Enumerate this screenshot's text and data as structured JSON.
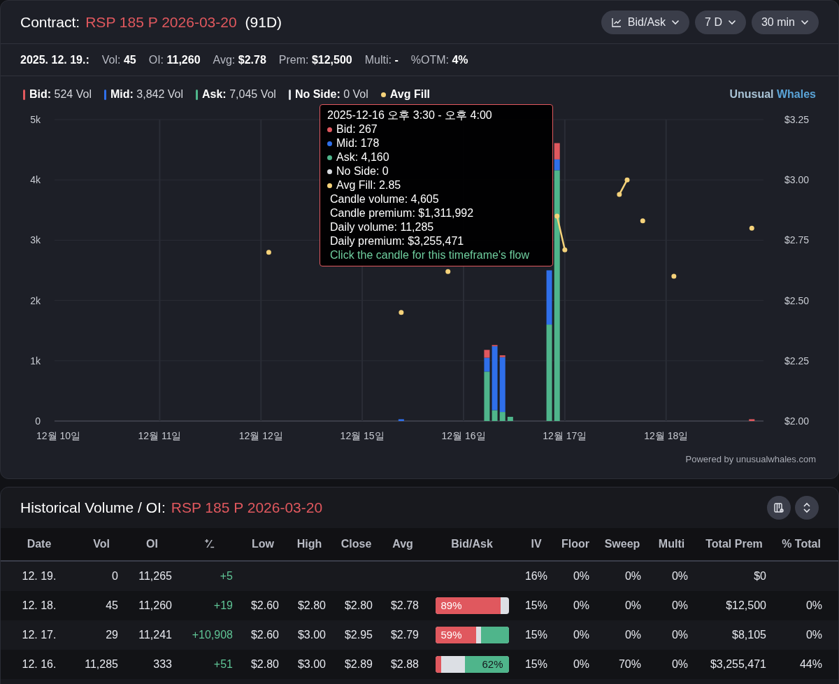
{
  "header": {
    "label": "Contract:",
    "contract": "RSP 185 P 2026-03-20",
    "days": "(91D)",
    "controls": [
      {
        "kind": "chart",
        "label": "Bid/Ask"
      },
      {
        "kind": "plain",
        "label": "7 D"
      },
      {
        "kind": "plain",
        "label": "30 min"
      }
    ]
  },
  "stats": {
    "date": "2025. 12. 19.:",
    "items": [
      {
        "label": "Vol:",
        "value": "45"
      },
      {
        "label": "OI:",
        "value": "11,260"
      },
      {
        "label": "Avg:",
        "value": "$2.78"
      },
      {
        "label": "Prem:",
        "value": "$12,500"
      },
      {
        "label": "Multi:",
        "value": "-"
      },
      {
        "label": "%OTM:",
        "value": "4%"
      }
    ]
  },
  "legend_values": [
    "524 Vol",
    "3,842 Vol",
    "7,045 Vol",
    "0 Vol"
  ],
  "brand": {
    "first": "Unusual",
    "second": "Whales"
  },
  "volume_chart": {
    "chart_data": {
      "type": "bar",
      "stacked": true,
      "grid": true,
      "ylim": [
        0,
        5000
      ],
      "categories": [
        "12월 10일",
        null,
        null,
        null,
        null,
        null,
        null,
        null,
        null,
        null,
        null,
        null,
        null,
        "12월 11일",
        null,
        null,
        null,
        null,
        null,
        null,
        null,
        null,
        null,
        null,
        null,
        null,
        "12월 12일",
        null,
        null,
        null,
        null,
        null,
        null,
        null,
        null,
        null,
        null,
        null,
        null,
        "12월 15일",
        null,
        null,
        null,
        null,
        null,
        null,
        null,
        null,
        null,
        null,
        null,
        null,
        "12월 16일",
        null,
        null,
        null,
        null,
        null,
        null,
        null,
        null,
        null,
        null,
        null,
        null,
        "12월 17일",
        null,
        null,
        null,
        null,
        null,
        null,
        null,
        null,
        null,
        null,
        null,
        null,
        "12월 18일",
        null,
        null,
        null,
        null,
        null,
        null,
        null,
        null,
        null,
        null,
        null,
        null
      ],
      "yticks": [
        {
          "value": 0,
          "label": "0"
        },
        {
          "value": 1000,
          "label": "1k"
        },
        {
          "value": 2000,
          "label": "2k"
        },
        {
          "value": 3000,
          "label": "3k"
        },
        {
          "value": 4000,
          "label": "4k"
        },
        {
          "value": 5000,
          "label": "5k"
        }
      ],
      "series": [
        {
          "name": "Bid:",
          "color": "#e0585e",
          "values": [
            0,
            0,
            0,
            0,
            0,
            0,
            0,
            0,
            0,
            0,
            0,
            0,
            0,
            0,
            0,
            0,
            0,
            0,
            0,
            0,
            0,
            0,
            0,
            0,
            0,
            0,
            0,
            0,
            0,
            0,
            0,
            0,
            0,
            0,
            0,
            0,
            0,
            0,
            0,
            0,
            0,
            0,
            0,
            0,
            0,
            0,
            0,
            0,
            0,
            0,
            0,
            0,
            0,
            0,
            0,
            130,
            20,
            30,
            0,
            0,
            0,
            0,
            0,
            0,
            270,
            0,
            0,
            0,
            0,
            0,
            0,
            0,
            0,
            0,
            0,
            0,
            0,
            0,
            0,
            0,
            0,
            0,
            0,
            0,
            0,
            0,
            0,
            0,
            0,
            30,
            0
          ]
        },
        {
          "name": "Mid:",
          "color": "#2f6fea",
          "values": [
            0,
            0,
            0,
            0,
            0,
            0,
            0,
            0,
            0,
            0,
            0,
            0,
            0,
            0,
            0,
            0,
            0,
            0,
            0,
            0,
            0,
            0,
            0,
            0,
            0,
            0,
            0,
            0,
            0,
            0,
            0,
            0,
            0,
            0,
            0,
            0,
            0,
            0,
            0,
            0,
            0,
            0,
            0,
            0,
            30,
            0,
            0,
            0,
            0,
            0,
            0,
            0,
            0,
            0,
            0,
            230,
            1060,
            910,
            0,
            0,
            0,
            0,
            0,
            900,
            180,
            0,
            0,
            0,
            0,
            0,
            0,
            0,
            0,
            0,
            0,
            0,
            0,
            0,
            0,
            0,
            0,
            0,
            0,
            0,
            0,
            0,
            0,
            0,
            0,
            0,
            0
          ]
        },
        {
          "name": "Ask:",
          "color": "#4fb58b",
          "values": [
            0,
            0,
            0,
            0,
            0,
            0,
            0,
            0,
            0,
            0,
            0,
            0,
            0,
            0,
            0,
            0,
            0,
            0,
            0,
            0,
            0,
            0,
            0,
            0,
            0,
            0,
            0,
            0,
            0,
            0,
            0,
            0,
            0,
            0,
            0,
            0,
            0,
            0,
            0,
            0,
            0,
            0,
            0,
            0,
            0,
            0,
            0,
            0,
            0,
            0,
            0,
            0,
            0,
            0,
            0,
            820,
            180,
            150,
            70,
            0,
            0,
            0,
            0,
            1600,
            4160,
            0,
            0,
            0,
            0,
            0,
            0,
            0,
            0,
            0,
            0,
            0,
            0,
            0,
            0,
            0,
            0,
            0,
            0,
            0,
            0,
            0,
            0,
            0,
            0,
            0,
            0
          ]
        },
        {
          "name": "No Side:",
          "color": "#d8dbe0",
          "values": [
            0,
            0,
            0,
            0,
            0,
            0,
            0,
            0,
            0,
            0,
            0,
            0,
            0,
            0,
            0,
            0,
            0,
            0,
            0,
            0,
            0,
            0,
            0,
            0,
            0,
            0,
            0,
            0,
            0,
            0,
            0,
            0,
            0,
            0,
            0,
            0,
            0,
            0,
            0,
            0,
            0,
            0,
            0,
            0,
            0,
            0,
            0,
            0,
            0,
            0,
            0,
            0,
            0,
            0,
            0,
            0,
            0,
            0,
            0,
            0,
            0,
            0,
            0,
            0,
            0,
            0,
            0,
            0,
            0,
            0,
            0,
            0,
            0,
            0,
            0,
            0,
            0,
            0,
            0,
            0,
            0,
            0,
            0,
            0,
            0,
            0,
            0,
            0,
            0,
            0,
            0
          ]
        }
      ]
    }
  },
  "price_chart": {
    "chart_data": {
      "type": "line",
      "ylim": [
        2.0,
        3.25
      ],
      "categories": [
        null,
        null,
        null,
        null,
        null,
        null,
        null,
        null,
        null,
        null,
        null,
        null,
        null,
        null,
        null,
        null,
        null,
        null,
        null,
        null,
        null,
        null,
        null,
        null,
        null,
        null,
        null,
        null,
        null,
        null,
        null,
        null,
        null,
        null,
        null,
        null,
        null,
        null,
        null,
        null,
        null,
        null,
        null,
        null,
        null,
        null,
        null,
        null,
        null,
        null,
        null,
        null,
        null,
        null,
        null,
        null,
        null,
        null,
        null,
        null,
        null,
        null,
        null,
        null,
        null,
        null,
        null,
        null,
        null,
        null,
        null,
        null,
        null,
        null,
        null,
        null,
        null,
        null,
        null,
        null,
        null,
        null,
        null,
        null,
        null,
        null,
        null,
        null,
        null,
        null,
        null
      ],
      "yticks": [
        {
          "value": 2.0,
          "label": "$2.00"
        },
        {
          "value": 2.25,
          "label": "$2.25"
        },
        {
          "value": 2.5,
          "label": "$2.50"
        },
        {
          "value": 2.75,
          "label": "$2.75"
        },
        {
          "value": 3.0,
          "label": "$3.00"
        },
        {
          "value": 3.25,
          "label": "$3.25"
        }
      ],
      "series": [
        {
          "name": "Avg Fill",
          "color": "#f5d27a",
          "marker": true,
          "values": [
            null,
            null,
            null,
            null,
            null,
            null,
            null,
            null,
            null,
            null,
            null,
            null,
            null,
            null,
            null,
            null,
            null,
            null,
            null,
            null,
            null,
            null,
            null,
            null,
            null,
            null,
            null,
            2.7,
            null,
            null,
            null,
            null,
            null,
            null,
            null,
            null,
            null,
            null,
            null,
            null,
            null,
            null,
            null,
            null,
            2.45,
            null,
            null,
            null,
            null,
            null,
            2.62,
            null,
            null,
            null,
            null,
            null,
            null,
            null,
            null,
            null,
            null,
            null,
            null,
            null,
            2.85,
            2.71,
            null,
            null,
            null,
            null,
            null,
            null,
            2.94,
            3.0,
            null,
            2.83,
            null,
            null,
            null,
            2.6,
            null,
            null,
            null,
            null,
            null,
            null,
            null,
            null,
            null,
            2.8,
            null
          ]
        }
      ]
    }
  },
  "tooltip": {
    "title": "2025-12-16 오후 3:30 - 오후 4:00",
    "series": [
      {
        "color": "#e0585e",
        "text": "Bid: 267"
      },
      {
        "color": "#2f6fea",
        "text": "Mid: 178"
      },
      {
        "color": "#4fb58b",
        "text": "Ask: 4,160"
      },
      {
        "color": "#d8dbe0",
        "text": "No Side: 0"
      },
      {
        "color": "#f5d27a",
        "text": "Avg Fill: 2.85"
      }
    ],
    "lines": [
      "Candle volume: 4,605",
      "Candle premium: $1,311,992",
      "Daily volume: 11,285",
      "Daily premium: $3,255,471"
    ],
    "link": "Click the candle for this timeframe's flow"
  },
  "footer": "Powered by unusualwhales.com",
  "history": {
    "label": "Historical Volume / OI:",
    "contract": "RSP 185 P 2026-03-20",
    "columns": [
      "Date",
      "Vol",
      "OI",
      "⁺∕₋",
      "Low",
      "High",
      "Close",
      "Avg",
      "Bid/Ask",
      "IV",
      "Floor",
      "Sweep",
      "Multi",
      "Total Prem",
      "% Total"
    ],
    "rows": [
      {
        "date": "12. 19.",
        "vol": "0",
        "oi": "11,265",
        "change": "+5",
        "iv": "16%",
        "floor": "0%",
        "sweep": "0%",
        "multi": "0%",
        "total_prem": "$0"
      },
      {
        "date": "12. 18.",
        "vol": "45",
        "oi": "11,260",
        "change": "+19",
        "low": "$2.60",
        "high": "$2.80",
        "close": "$2.80",
        "avg": "$2.78",
        "bid_ask": {
          "label": "89%",
          "label_on_ask": false,
          "bid": {
            "level": 0.89
          }
        },
        "iv": "15%",
        "floor": "0%",
        "sweep": "0%",
        "multi": "0%",
        "total_prem": "$12,500",
        "pct_total": "0%"
      },
      {
        "date": "12. 17.",
        "vol": "29",
        "oi": "11,241",
        "change": "+10,908",
        "low": "$2.60",
        "high": "$3.00",
        "close": "$2.95",
        "avg": "$2.79",
        "bid_ask": {
          "label": "59%",
          "label_on_ask": false,
          "bid": {
            "level": 0.56
          },
          "ask": {
            "level": 0.38
          }
        },
        "iv": "15%",
        "floor": "0%",
        "sweep": "0%",
        "multi": "0%",
        "total_prem": "$8,105",
        "pct_total": "0%"
      },
      {
        "date": "12. 16.",
        "vol": "11,285",
        "oi": "333",
        "change": "+51",
        "low": "$2.80",
        "high": "$3.00",
        "close": "$2.89",
        "avg": "$2.88",
        "bid_ask": {
          "label": "62%",
          "label_on_ask": true,
          "bid": {
            "level": 0.08
          },
          "ask": {
            "level": 0.6
          }
        },
        "iv": "15%",
        "floor": "0%",
        "sweep": "70%",
        "multi": "0%",
        "total_prem": "$3,255,471",
        "pct_total": "44%"
      }
    ]
  }
}
